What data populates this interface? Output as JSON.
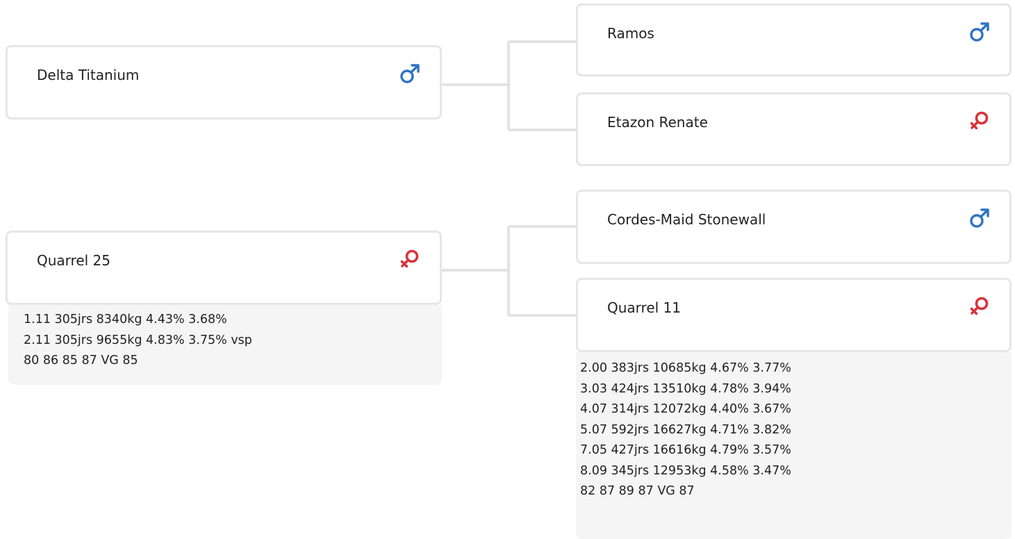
{
  "colors": {
    "male": "#2f72c4",
    "female": "#d8343a",
    "border": "#e6e6e6",
    "stats_bg": "#f5f5f5"
  },
  "pedigree": {
    "sire": {
      "name": "Delta Titanium",
      "sex_icon": "male-icon",
      "sire": {
        "name": "Ramos",
        "sex_icon": "male-icon"
      },
      "dam": {
        "name": "Etazon Renate",
        "sex_icon": "female-icon"
      }
    },
    "dam": {
      "name": "Quarrel 25",
      "sex_icon": "female-icon",
      "stats": [
        "1.11 305jrs 8340kg 4.43% 3.68%",
        "2.11 305jrs 9655kg 4.83% 3.75% vsp",
        "80 86 85 87 VG 85"
      ],
      "sire": {
        "name": "Cordes-Maid Stonewall",
        "sex_icon": "male-icon"
      },
      "dam": {
        "name": "Quarrel 11",
        "sex_icon": "female-icon",
        "stats": [
          "2.00 383jrs 10685kg 4.67% 3.77%",
          "3.03 424jrs 13510kg 4.78% 3.94%",
          "4.07 314jrs 12072kg 4.40% 3.67%",
          "5.07 592jrs 16627kg 4.71% 3.82%",
          "7.05 427jrs 16616kg 4.79% 3.57%",
          "8.09 345jrs 12953kg 4.58% 3.47%",
          "82 87 89 87 VG 87"
        ]
      }
    }
  }
}
